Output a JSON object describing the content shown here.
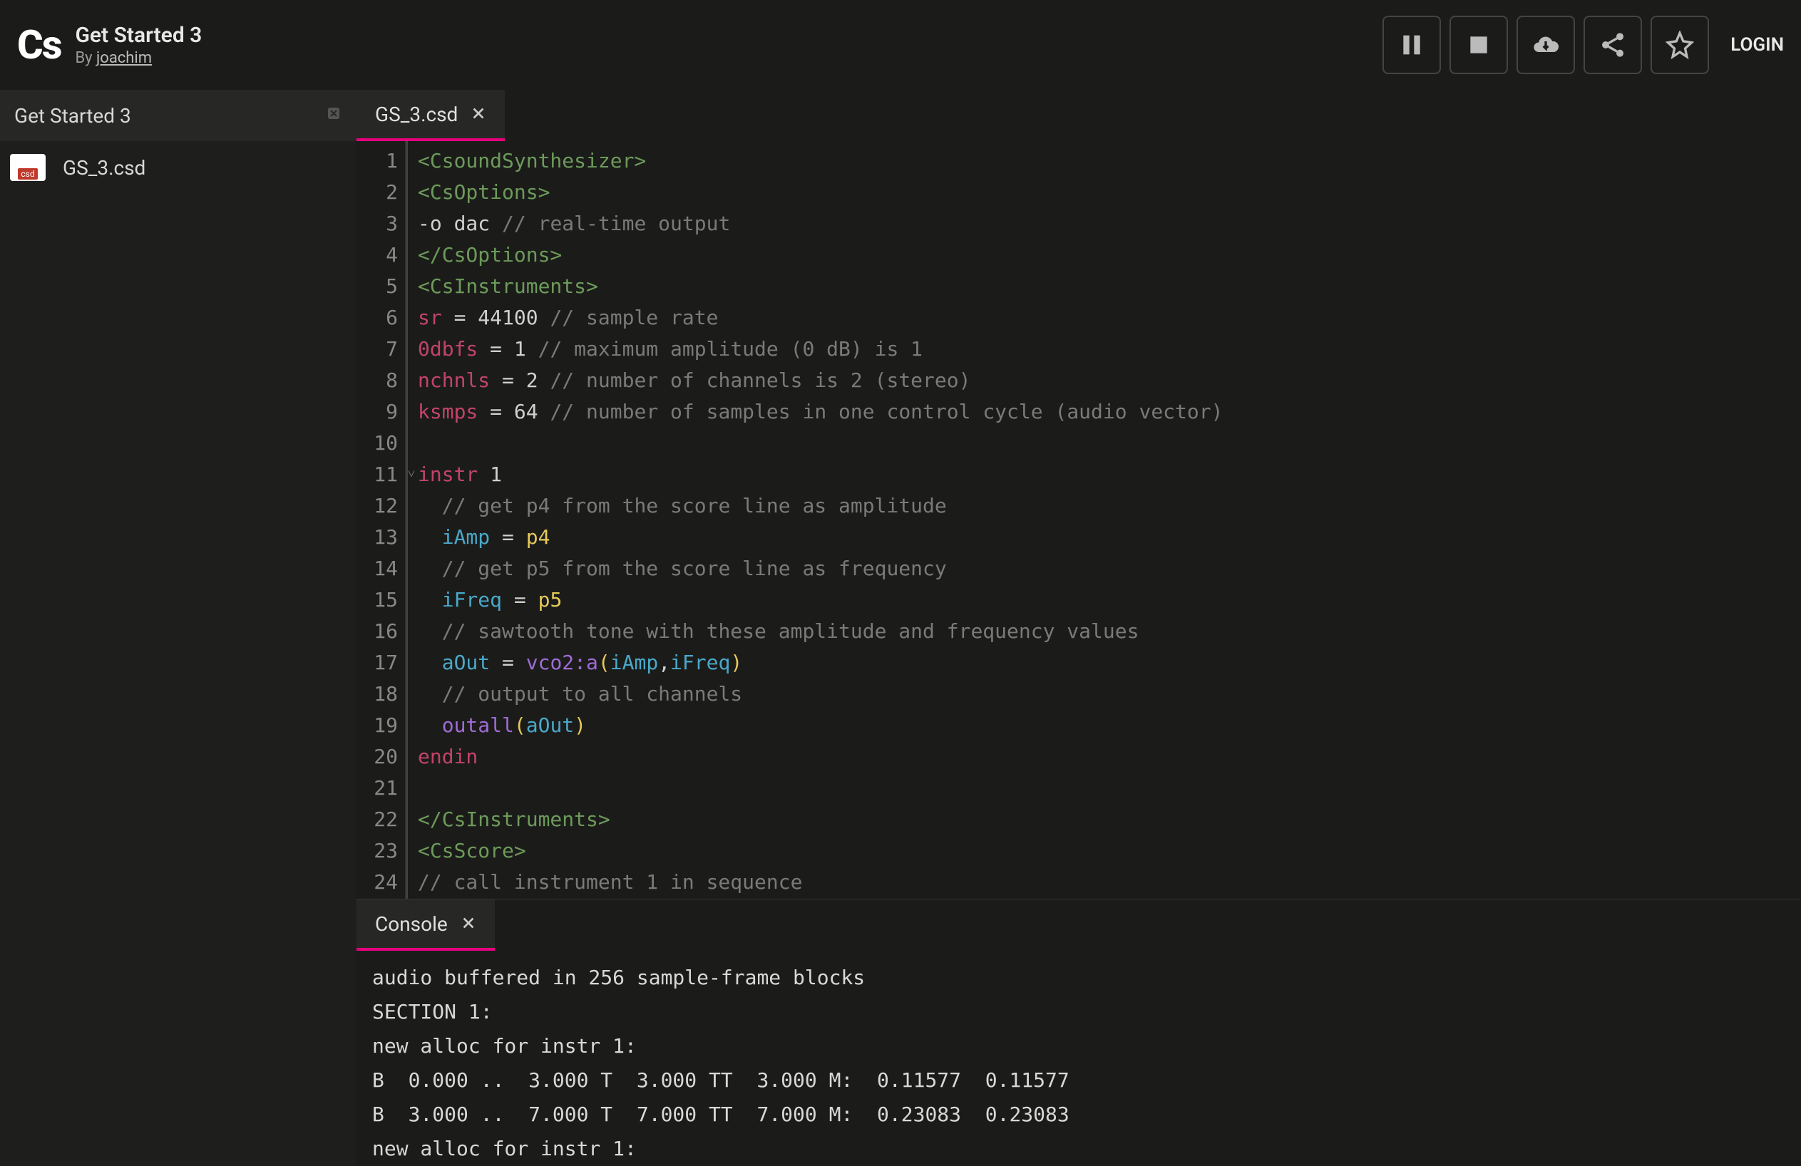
{
  "header": {
    "logo": "Cs",
    "title": "Get Started 3",
    "by_prefix": "By ",
    "author": "joachim",
    "login": "LOGIN"
  },
  "sidebar": {
    "title": "Get Started 3",
    "files": [
      {
        "name": "GS_3.csd"
      }
    ]
  },
  "editor": {
    "tab_label": "GS_3.csd",
    "lines": [
      {
        "n": 1,
        "tokens": [
          {
            "t": "<CsoundSynthesizer>",
            "c": "tag"
          }
        ]
      },
      {
        "n": 2,
        "tokens": [
          {
            "t": "<CsOptions>",
            "c": "tag"
          }
        ]
      },
      {
        "n": 3,
        "tokens": [
          {
            "t": "-o dac ",
            "c": "plain"
          },
          {
            "t": "// real-time output",
            "c": "comment"
          }
        ]
      },
      {
        "n": 4,
        "tokens": [
          {
            "t": "</CsOptions>",
            "c": "tag"
          }
        ]
      },
      {
        "n": 5,
        "tokens": [
          {
            "t": "<CsInstruments>",
            "c": "tag"
          }
        ]
      },
      {
        "n": 6,
        "tokens": [
          {
            "t": "sr",
            "c": "kw"
          },
          {
            "t": " = 44100 ",
            "c": "plain"
          },
          {
            "t": "// sample rate",
            "c": "comment"
          }
        ]
      },
      {
        "n": 7,
        "tokens": [
          {
            "t": "0dbfs",
            "c": "kw"
          },
          {
            "t": " = 1 ",
            "c": "plain"
          },
          {
            "t": "// maximum amplitude (0 dB) is 1",
            "c": "comment"
          }
        ]
      },
      {
        "n": 8,
        "tokens": [
          {
            "t": "nchnls",
            "c": "kw"
          },
          {
            "t": " = 2 ",
            "c": "plain"
          },
          {
            "t": "// number of channels is 2 (stereo)",
            "c": "comment"
          }
        ]
      },
      {
        "n": 9,
        "tokens": [
          {
            "t": "ksmps",
            "c": "kw"
          },
          {
            "t": " = 64 ",
            "c": "plain"
          },
          {
            "t": "// number of samples in one control cycle (audio vector)",
            "c": "comment"
          }
        ]
      },
      {
        "n": 10,
        "tokens": [
          {
            "t": "",
            "c": "plain"
          }
        ]
      },
      {
        "n": 11,
        "fold": true,
        "tokens": [
          {
            "t": "instr",
            "c": "kw"
          },
          {
            "t": " 1",
            "c": "plain"
          }
        ]
      },
      {
        "n": 12,
        "tokens": [
          {
            "t": "  ",
            "c": "plain"
          },
          {
            "t": "// get p4 from the score line as amplitude",
            "c": "comment"
          }
        ]
      },
      {
        "n": 13,
        "tokens": [
          {
            "t": "  ",
            "c": "plain"
          },
          {
            "t": "iAmp",
            "c": "var"
          },
          {
            "t": " = ",
            "c": "plain"
          },
          {
            "t": "p4",
            "c": "param"
          }
        ]
      },
      {
        "n": 14,
        "tokens": [
          {
            "t": "  ",
            "c": "plain"
          },
          {
            "t": "// get p5 from the score line as frequency",
            "c": "comment"
          }
        ]
      },
      {
        "n": 15,
        "tokens": [
          {
            "t": "  ",
            "c": "plain"
          },
          {
            "t": "iFreq",
            "c": "var"
          },
          {
            "t": " = ",
            "c": "plain"
          },
          {
            "t": "p5",
            "c": "param"
          }
        ]
      },
      {
        "n": 16,
        "tokens": [
          {
            "t": "  ",
            "c": "plain"
          },
          {
            "t": "// sawtooth tone with these amplitude and frequency values",
            "c": "comment"
          }
        ]
      },
      {
        "n": 17,
        "tokens": [
          {
            "t": "  ",
            "c": "plain"
          },
          {
            "t": "aOut",
            "c": "var"
          },
          {
            "t": " = ",
            "c": "plain"
          },
          {
            "t": "vco2:a",
            "c": "func"
          },
          {
            "t": "(",
            "c": "paren"
          },
          {
            "t": "iAmp",
            "c": "var"
          },
          {
            "t": ",",
            "c": "punc"
          },
          {
            "t": "iFreq",
            "c": "var"
          },
          {
            "t": ")",
            "c": "paren"
          }
        ]
      },
      {
        "n": 18,
        "tokens": [
          {
            "t": "  ",
            "c": "plain"
          },
          {
            "t": "// output to all channels",
            "c": "comment"
          }
        ]
      },
      {
        "n": 19,
        "tokens": [
          {
            "t": "  ",
            "c": "plain"
          },
          {
            "t": "outall",
            "c": "func"
          },
          {
            "t": "(",
            "c": "paren"
          },
          {
            "t": "aOut",
            "c": "var"
          },
          {
            "t": ")",
            "c": "paren"
          }
        ]
      },
      {
        "n": 20,
        "tokens": [
          {
            "t": "endin",
            "c": "kw"
          }
        ]
      },
      {
        "n": 21,
        "tokens": [
          {
            "t": "",
            "c": "plain"
          }
        ]
      },
      {
        "n": 22,
        "tokens": [
          {
            "t": "</CsInstruments>",
            "c": "tag"
          }
        ]
      },
      {
        "n": 23,
        "tokens": [
          {
            "t": "<CsScore>",
            "c": "tag"
          }
        ]
      },
      {
        "n": 24,
        "tokens": [
          {
            "t": "// call instrument 1 in sequence",
            "c": "comment"
          }
        ]
      }
    ]
  },
  "console": {
    "tab_label": "Console",
    "output": "audio buffered in 256 sample-frame blocks\nSECTION 1:\nnew alloc for instr 1:\nB  0.000 ..  3.000 T  3.000 TT  3.000 M:  0.11577  0.11577\nB  3.000 ..  7.000 T  7.000 TT  7.000 M:  0.23083  0.23083\nnew alloc for instr 1:"
  }
}
